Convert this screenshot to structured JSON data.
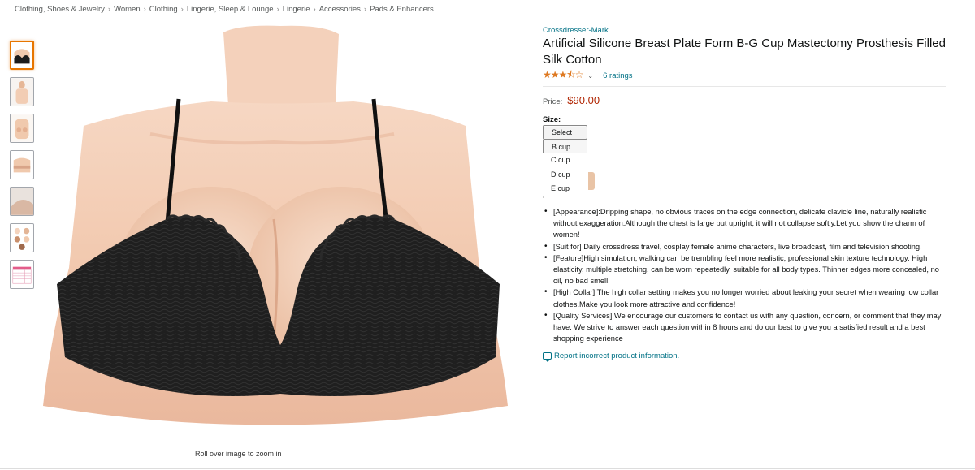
{
  "breadcrumb": [
    "Clothing, Shoes & Jewelry",
    "Women",
    "Clothing",
    "Lingerie, Sleep & Lounge",
    "Lingerie",
    "Accessories",
    "Pads & Enhancers"
  ],
  "breadcrumb_separator": "›",
  "thumbnails": [
    "product-view-front",
    "product-view-model",
    "product-view-side",
    "product-view-back",
    "product-view-detail",
    "product-view-colors",
    "product-view-size-chart"
  ],
  "zoom_hint": "Roll over image to zoom in",
  "product": {
    "brand": "Crossdresser-Mark",
    "title": "Artificial Silicone Breast Plate Form B-G Cup Mastectomy Prosthesis Filled Silk Cotton",
    "stars": 3.5,
    "ratings_label": "6 ratings",
    "price_label": "Price:",
    "price": "$90.00",
    "size_label": "Size:"
  },
  "size_dropdown": {
    "options": [
      "Select",
      "B cup",
      "C cup",
      "D cup",
      "E cup"
    ],
    "selected": "Select",
    "highlighted": "B cup"
  },
  "bullets": [
    "[Appearance]:Dripping shape, no obvious traces on the edge connection, delicate clavicle line, naturally realistic without exaggeration.Although the chest is large but upright, it will not collapse softly.Let you show the charm of women!",
    "[Suit for] Daily crossdress travel, cosplay female anime characters, live broadcast, film and television shooting.",
    "[Feature]High simulation, walking can be trembling feel more realistic, professional skin texture technology. High elasticity, multiple stretching, can be worn repeatedly, suitable for all body types. Thinner edges more concealed, no oil, no bad smell.",
    "[High Collar] The high collar setting makes you no longer worried about leaking your secret when wearing low collar clothes.Make you look more attractive and confidence!",
    "[Quality Services] We encourage our customers to contact us with any question, concern, or comment that they may have. We strive to answer each question within 8 hours and do our best to give you a satisfied result and a best shopping experience"
  ],
  "report_link": "Report incorrect product information.",
  "colors": {
    "link": "#007185",
    "price": "#b12704",
    "star": "#de7921",
    "skin": "#f2cdb4",
    "bra": "#1c1c1c"
  }
}
